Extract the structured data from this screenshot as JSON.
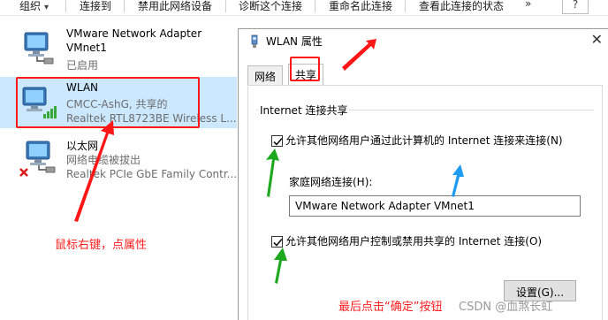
{
  "toolbar": {
    "items": [
      {
        "label": "组织"
      },
      {
        "label": "连接到"
      },
      {
        "label": "禁用此网络设备"
      },
      {
        "label": "诊断这个连接"
      },
      {
        "label": "重命名此连接"
      },
      {
        "label": "查看此连接的状态"
      }
    ],
    "more": "»",
    "help": "?"
  },
  "adapters": [
    {
      "name": "VMware Network Adapter",
      "line1": "VMnet1",
      "line2": "已启用"
    },
    {
      "name": "WLAN",
      "line1": "CMCC-AshG, 共享的",
      "line2": "Realtek RTL8723BE Wireless L..."
    },
    {
      "name": "以太网",
      "line1": "网络电缆被拔出",
      "line2": "Realtek PCIe GbE Family Contr..."
    }
  ],
  "dialog": {
    "title": "WLAN 属性",
    "close": "✕",
    "tabs": [
      {
        "label": "网络"
      },
      {
        "label": "共享"
      }
    ],
    "group_title": "Internet 连接共享",
    "allow_share_label": "允许其他网络用户通过此计算机的 Internet 连接来连接(N)",
    "allow_share_checked": true,
    "home_network_label": "家庭网络连接(H):",
    "home_network_value": "VMware Network Adapter VMnet1",
    "allow_control_label": "允许其他网络用户控制或禁用共享的 Internet 连接(O)",
    "allow_control_checked": true,
    "settings_button": "设置(G)..."
  },
  "annotations": {
    "right_click_note": "鼠标右键，点属性",
    "confirm_note": "最后点击“确定”按钮",
    "watermark": "CSDN @血煞长虹",
    "red": "#ff1616",
    "green": "#1ea81e",
    "blue": "#1e9cf0"
  }
}
